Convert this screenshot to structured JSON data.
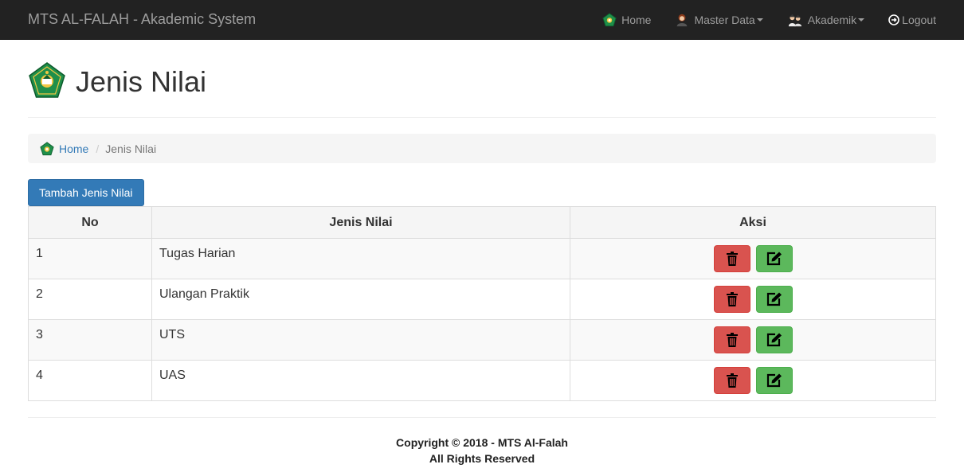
{
  "navbar": {
    "brand": "MTS AL-FALAH - Akademic System",
    "items": [
      {
        "label": "Home",
        "icon": "school-logo-icon"
      },
      {
        "label": "Master Data",
        "icon": "teacher-icon"
      },
      {
        "label": "Akademik",
        "icon": "students-icon"
      },
      {
        "label": "Logout",
        "icon": "logout-icon"
      }
    ]
  },
  "page": {
    "title": "Jenis Nilai"
  },
  "breadcrumb": {
    "home": "Home",
    "separator": "/",
    "current": "Jenis Nilai"
  },
  "add_button": "Tambah Jenis Nilai",
  "table": {
    "headers": [
      "No",
      "Jenis Nilai",
      "Aksi"
    ],
    "rows": [
      {
        "no": "1",
        "jenis": "Tugas Harian"
      },
      {
        "no": "2",
        "jenis": "Ulangan Praktik"
      },
      {
        "no": "3",
        "jenis": "UTS"
      },
      {
        "no": "4",
        "jenis": "UAS"
      }
    ],
    "actions": {
      "delete_icon": "trash-icon",
      "edit_icon": "edit-icon"
    }
  },
  "footer": {
    "line1": "Copyright © 2018 - MTS Al-Falah",
    "line2": "All Rights Reserved"
  },
  "colors": {
    "navbar": "#222222",
    "primary": "#337ab7",
    "danger": "#d9534f",
    "success": "#5cb85c"
  }
}
